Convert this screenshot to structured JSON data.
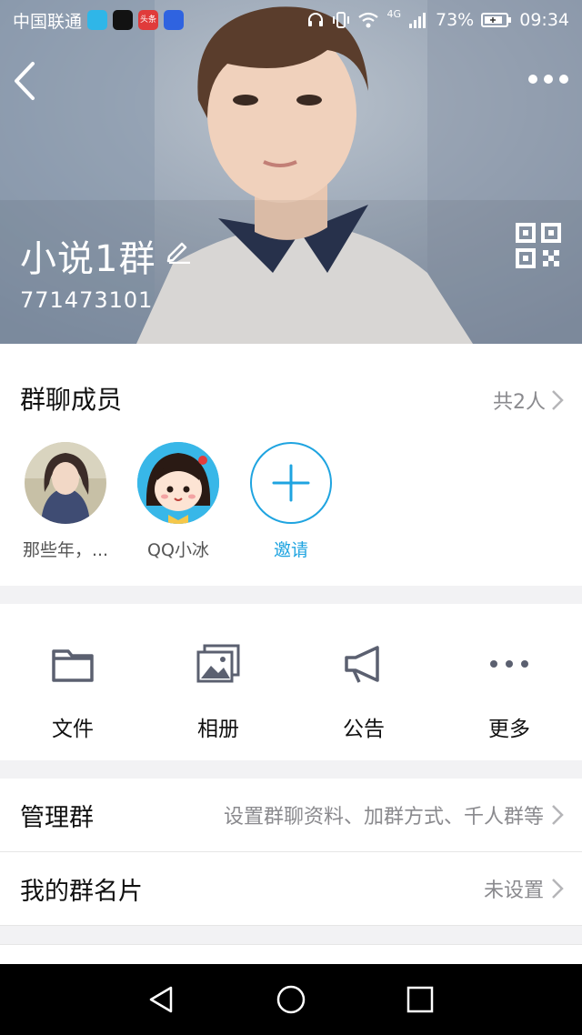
{
  "status_bar": {
    "carrier": "中国联通",
    "network": "4G",
    "battery": "73%",
    "time": "09:34",
    "app_icons": [
      {
        "name": "video-app-icon",
        "color": "#2fb6e8"
      },
      {
        "name": "douyin-icon",
        "color": "#121212"
      },
      {
        "name": "toutiao-icon",
        "color": "#e03b3b",
        "label": "头条"
      },
      {
        "name": "baidu-icon",
        "color": "#2f63e0"
      }
    ]
  },
  "hero": {
    "group_name": "小说1群",
    "group_id": "771473101"
  },
  "members": {
    "title": "群聊成员",
    "count": "共2人",
    "items": [
      {
        "name": "那些年，...",
        "avatar": "girl-photo-avatar"
      },
      {
        "name": "QQ小冰",
        "avatar": "cartoon-girl-avatar"
      }
    ],
    "invite_label": "邀请"
  },
  "actions": [
    {
      "label": "文件",
      "icon": "folder-icon"
    },
    {
      "label": "相册",
      "icon": "album-icon"
    },
    {
      "label": "公告",
      "icon": "megaphone-icon"
    },
    {
      "label": "更多",
      "icon": "more-dots-icon"
    }
  ],
  "list": [
    {
      "label": "管理群",
      "value": "设置群聊资料、加群方式、千人群等"
    },
    {
      "label": "我的群名片",
      "value": "未设置"
    }
  ],
  "colors": {
    "accent": "#1fa4e0",
    "icon_gray": "#5b6070",
    "secondary_text": "#8a8a8e"
  }
}
